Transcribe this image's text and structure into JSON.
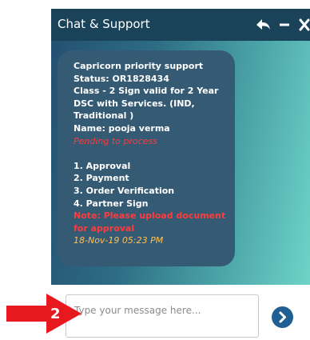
{
  "header": {
    "title": "Chat & Support",
    "controls": [
      "reply-icon",
      "minimize-icon",
      "close-icon"
    ]
  },
  "message": {
    "lines": [
      "Capricorn priority support",
      "Status: OR1828434",
      "Class - 2 Sign valid for 2 Year",
      "DSC with Services. (IND,",
      "Traditional )",
      "Name: pooja verma"
    ],
    "pending": "Pending to process",
    "steps": [
      "1. Approval",
      "2. Payment",
      "3. Order Verification",
      "4. Partner Sign"
    ],
    "note_lines": [
      "Note: Please upload document",
      "for approval"
    ],
    "timestamp": "18-Nov-19 05:23 PM"
  },
  "input": {
    "placeholder": "Type your message here...",
    "value": ""
  },
  "send_icon": "chevron-right-icon",
  "annotation": {
    "number": "2",
    "icon": "arrow-right-icon"
  },
  "colors": {
    "header": "#1a4258",
    "bubble": "#355a74",
    "pending_text": "#ff3b3b",
    "timestamp_text": "#ffc05a",
    "send_button": "#1f5f94",
    "annotation": "#e8191e"
  }
}
